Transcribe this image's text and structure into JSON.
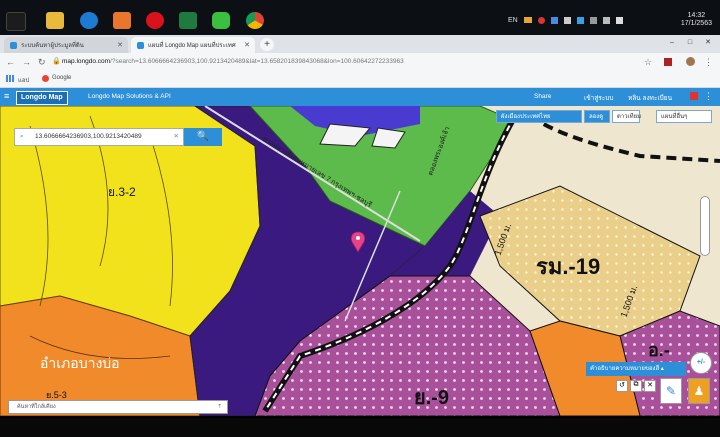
{
  "taskbar": {
    "language": "EN",
    "clock_time": "14:32",
    "clock_date": "17/1/2563",
    "pinned_icons": [
      "file-explorer-icon",
      "internet-explorer-icon",
      "media-player-icon",
      "opera-icon",
      "excel-icon",
      "line-icon",
      "chrome-icon"
    ]
  },
  "browser": {
    "tabs": [
      {
        "label": "ระบบค้นหาผู้ประมูลที่ดิน",
        "active": false
      },
      {
        "label": "แผนที่ Longdo Map แผนที่ประเทศ",
        "active": true
      }
    ],
    "new_tab": "+",
    "window_controls": [
      "–",
      "□",
      "✕"
    ],
    "url_host": "map.longdo.com",
    "url_rest": "/?search=13.6066664236903,100.9213420489&lat=13.658201839843068&lon=100.60642272233963",
    "bookmarks": [
      "แอป",
      "Google"
    ]
  },
  "longdo": {
    "logo": "Longdo Map",
    "subtitle": "Longdo Map Solutions & API",
    "share": "Share",
    "login": "เข้าสู่ระบบ",
    "help": "หลิน ลงทะเบียน"
  },
  "map": {
    "search_value": "13.6066664236903,100.9213420489",
    "search_button": "🔍",
    "layer_buttons": [
      "ผังเมืองประเทศไทย",
      "ลองดู",
      "ดาวเทียม",
      "แผนที่อื่นๆ"
    ],
    "zone_labels": [
      "ย.3-2",
      "ย.5-3",
      "อำเภอบางบ่อ",
      "รม.-19",
      "ย.-9",
      "อ.-",
      "1,500 ม.",
      "1,500 ม."
    ],
    "road_labels": [
      "ทางหลวงพิเศษหมายเลข 7 กรุงเทพฯ-ชลบุรี",
      "คลองพระองค์เจ้า"
    ],
    "legend_button": "คำอธิบายความหมายของสี",
    "nearby_placeholder": "ค้นหาที่ใกล้เคียง",
    "zoom_label": "+/-",
    "pin_color": "#e8418a",
    "colors": {
      "yellow_zone": "#f2e21b",
      "orange_zone": "#f08a2a",
      "purple_zone": "#3a1a7e",
      "green_zone": "#5cbb4a",
      "pink_dotted": "#a8509a",
      "beige_zone": "#e9cf8a"
    }
  }
}
